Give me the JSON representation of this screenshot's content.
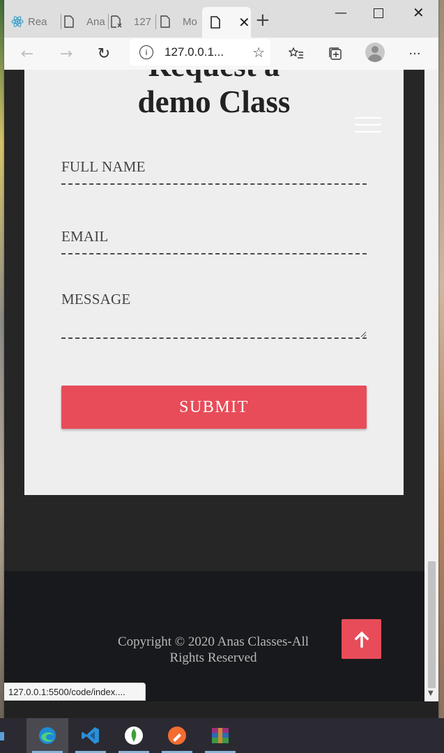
{
  "browser": {
    "tabs": [
      {
        "label": "Rea",
        "icon": "react-icon"
      },
      {
        "label": "Ana",
        "icon": "page-icon"
      },
      {
        "label": "127",
        "icon": "page-error-icon"
      },
      {
        "label": "Mo",
        "icon": "page-icon"
      },
      {
        "label": "",
        "icon": "page-icon",
        "active": true
      }
    ],
    "new_tab": "+",
    "address": "127.0.0.1...",
    "status_url": "127.0.0.1:5500/code/index...."
  },
  "page": {
    "title_line1": "Request a",
    "title_line2": "demo Class",
    "form": {
      "full_name_label": "FULL NAME",
      "email_label": "EMAIL",
      "message_label": "MESSAGE",
      "submit_label": "SUBMIT"
    },
    "footer": {
      "copyright_line1": "Copyright © 2020 Anas Classes-All",
      "copyright_line2": "Rights Reserved"
    }
  },
  "colors": {
    "accent": "#e84c59",
    "card": "#eeeeee",
    "footer": "#18191c"
  },
  "taskbar": {
    "items": [
      "edge-icon",
      "vscode-icon",
      "mongodb-icon",
      "postman-icon",
      "winrar-icon"
    ]
  }
}
